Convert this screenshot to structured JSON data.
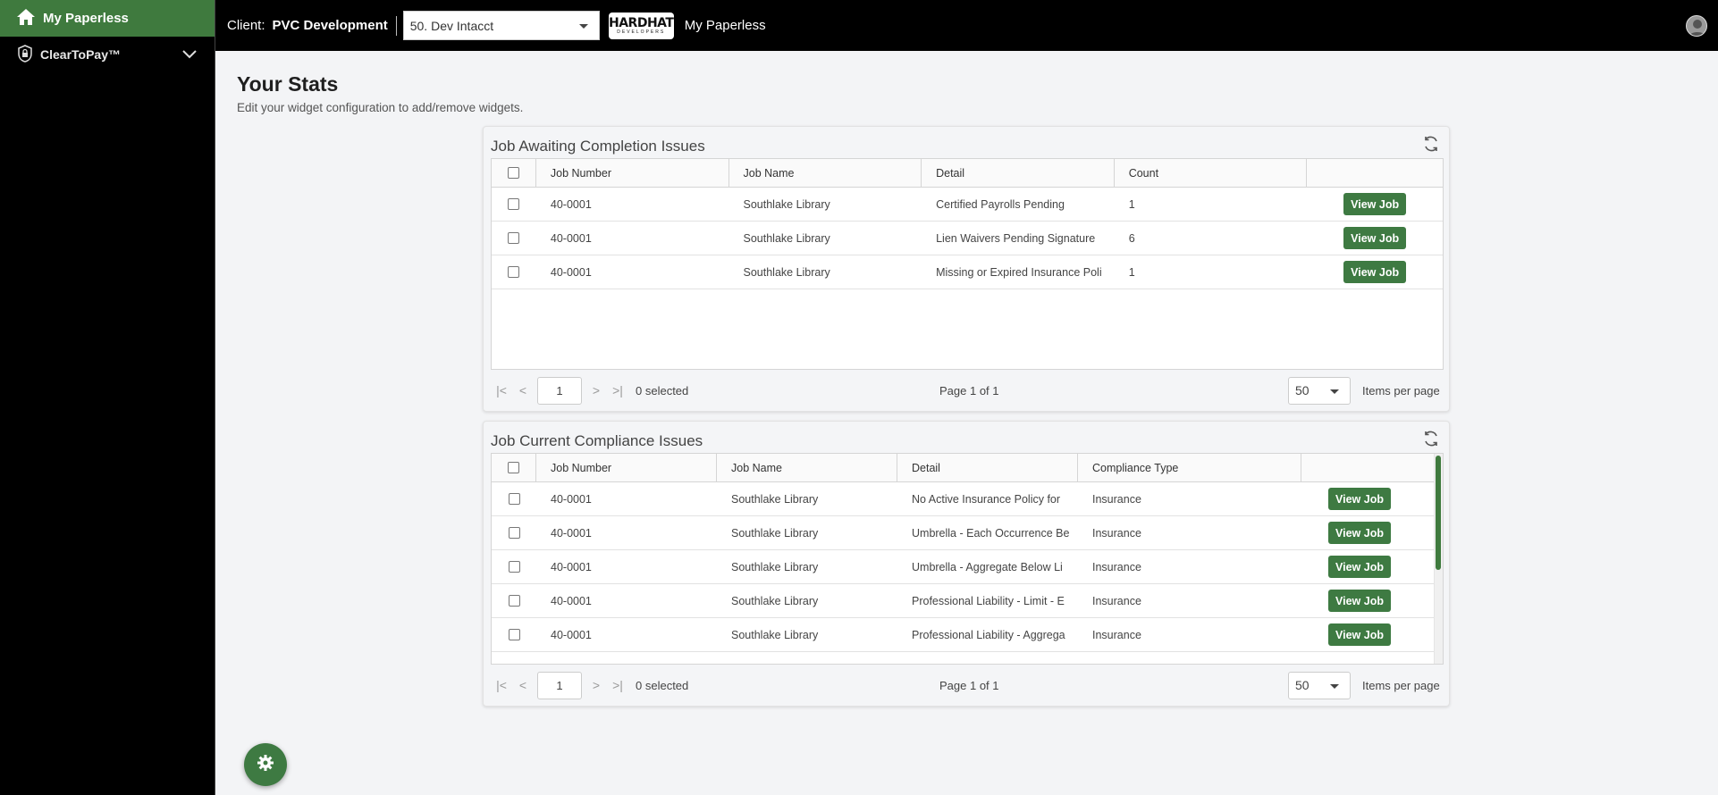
{
  "sidebar": {
    "home_label": "My Paperless",
    "items": [
      {
        "label": "ClearToPay™",
        "icon": "lock-icon"
      }
    ]
  },
  "topbar": {
    "client_label": "Client:",
    "client_name": "PVC Development",
    "client_select": "50. Dev Intacct",
    "logo_text": "HARDHAT",
    "logo_subtext": "DEVELOPERS",
    "title": "My Paperless"
  },
  "main": {
    "title": "Your Stats",
    "subtitle": "Edit your widget configuration to add/remove widgets."
  },
  "widget1": {
    "title": "Job Awaiting Completion Issues",
    "columns": [
      "Job Number",
      "Job Name",
      "Detail",
      "Count"
    ],
    "rows": [
      [
        "40-0001",
        "Southlake Library",
        "Certified Payrolls Pending",
        "1"
      ],
      [
        "40-0001",
        "Southlake Library",
        "Lien Waivers Pending Signature",
        "6"
      ],
      [
        "40-0001",
        "Southlake Library",
        "Missing or Expired Insurance Poli",
        "1"
      ]
    ],
    "button_label": "View Job",
    "pager": {
      "page_input": "1",
      "selected": "0 selected",
      "page_info": "Page 1 of 1",
      "per_page": "50",
      "per_page_label": "Items per page"
    }
  },
  "widget2": {
    "title": "Job Current Compliance Issues",
    "columns": [
      "Job Number",
      "Job Name",
      "Detail",
      "Compliance Type"
    ],
    "rows": [
      [
        "40-0001",
        "Southlake Library",
        "No Active Insurance Policy for",
        "Insurance"
      ],
      [
        "40-0001",
        "Southlake Library",
        "Umbrella - Each Occurrence Be",
        "Insurance"
      ],
      [
        "40-0001",
        "Southlake Library",
        "Umbrella - Aggregate Below Li",
        "Insurance"
      ],
      [
        "40-0001",
        "Southlake Library",
        "Professional Liability - Limit - E",
        "Insurance"
      ],
      [
        "40-0001",
        "Southlake Library",
        "Professional Liability - Aggrega",
        "Insurance"
      ]
    ],
    "button_label": "View Job",
    "pager": {
      "page_input": "1",
      "selected": "0 selected",
      "page_info": "Page 1 of 1",
      "per_page": "50",
      "per_page_label": "Items per page"
    }
  },
  "colors": {
    "accent": "#3e7a42",
    "topbar": "#000000"
  }
}
